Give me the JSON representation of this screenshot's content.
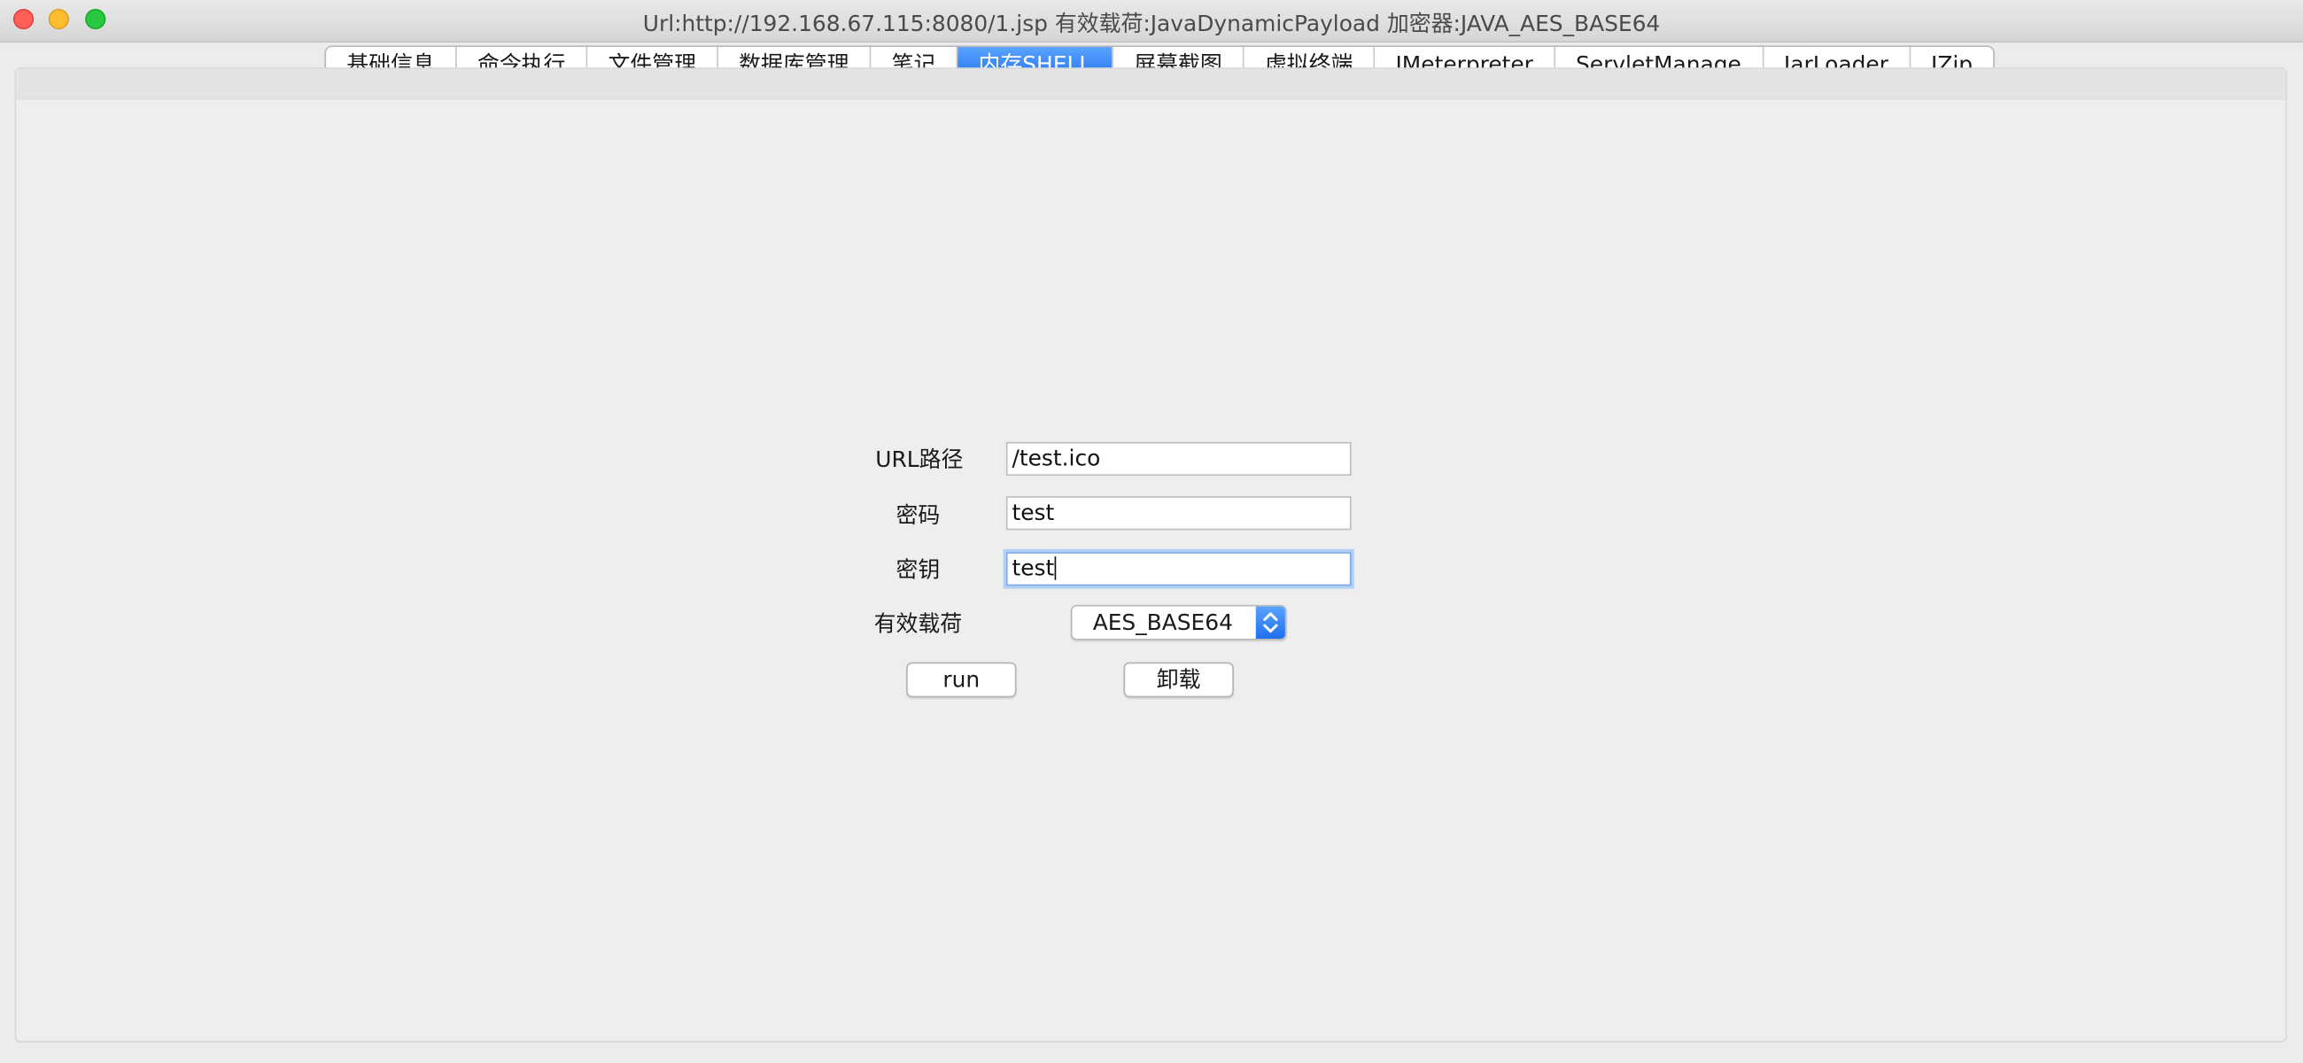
{
  "window": {
    "title": "Url:http://192.168.67.115:8080/1.jsp 有效载荷:JavaDynamicPayload 加密器:JAVA_AES_BASE64"
  },
  "tabs": [
    {
      "label": "基础信息"
    },
    {
      "label": "命令执行"
    },
    {
      "label": "文件管理"
    },
    {
      "label": "数据库管理"
    },
    {
      "label": "笔记"
    },
    {
      "label": "内存SHELL"
    },
    {
      "label": "屏幕截图"
    },
    {
      "label": "虚拟终端"
    },
    {
      "label": "JMeterpreter"
    },
    {
      "label": "ServletManage"
    },
    {
      "label": "JarLoader"
    },
    {
      "label": "JZip"
    }
  ],
  "active_tab": "内存SHELL",
  "form": {
    "url_path_label": "URL路径",
    "url_path_value": "/test.ico",
    "password_label": "密码",
    "password_value": "test",
    "key_label": "密钥",
    "key_value": "test",
    "payload_label": "有效载荷",
    "payload_selected": "AES_BASE64",
    "run_label": "run",
    "uninstall_label": "卸载"
  },
  "colors": {
    "accent": "#1f6ff0",
    "window_bg": "#ececec",
    "close": "#fe5f57",
    "minimize": "#febc2e",
    "maximize": "#28c840"
  }
}
